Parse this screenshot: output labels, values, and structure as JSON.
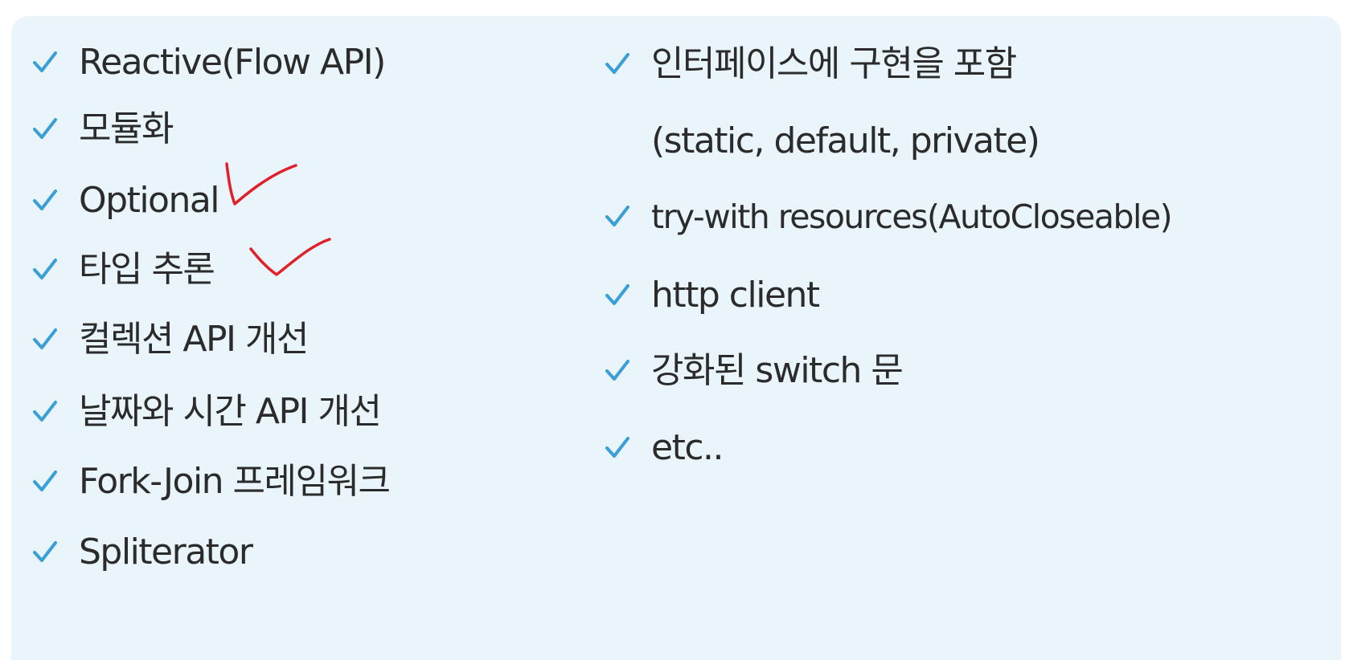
{
  "colors": {
    "panel_background": "#e9f5fb",
    "text": "#2b2b2b",
    "checkmark": "#3a9fd6",
    "annotation": "#e0202a"
  },
  "left_list": [
    {
      "icon": "checkmark-icon",
      "label": "Reactive(Flow API)"
    },
    {
      "icon": "checkmark-icon",
      "label": "모듈화"
    },
    {
      "icon": "checkmark-icon",
      "label": "Optional"
    },
    {
      "icon": "checkmark-icon",
      "label": "타입 추론"
    },
    {
      "icon": "checkmark-icon",
      "label": "컬렉션 API 개선"
    },
    {
      "icon": "checkmark-icon",
      "label": "날짜와 시간 API 개선"
    },
    {
      "icon": "checkmark-icon",
      "label": "Fork-Join 프레임워크"
    },
    {
      "icon": "checkmark-icon",
      "label": "Spliterator"
    }
  ],
  "right_list": [
    {
      "icon": "checkmark-icon",
      "label": "인터페이스에 구현을 포함",
      "continuation": "(static, default, private)"
    },
    {
      "icon": "checkmark-icon",
      "label": "try-with resources(AutoCloseable)"
    },
    {
      "icon": "checkmark-icon",
      "label": "http client"
    },
    {
      "icon": "checkmark-icon",
      "label": "강화된 switch 문"
    },
    {
      "icon": "checkmark-icon",
      "label": "etc.."
    }
  ],
  "annotations": [
    {
      "icon": "handwritten-check-icon",
      "marks": "Optional"
    },
    {
      "icon": "handwritten-check-icon",
      "marks": "타입 추론"
    }
  ]
}
